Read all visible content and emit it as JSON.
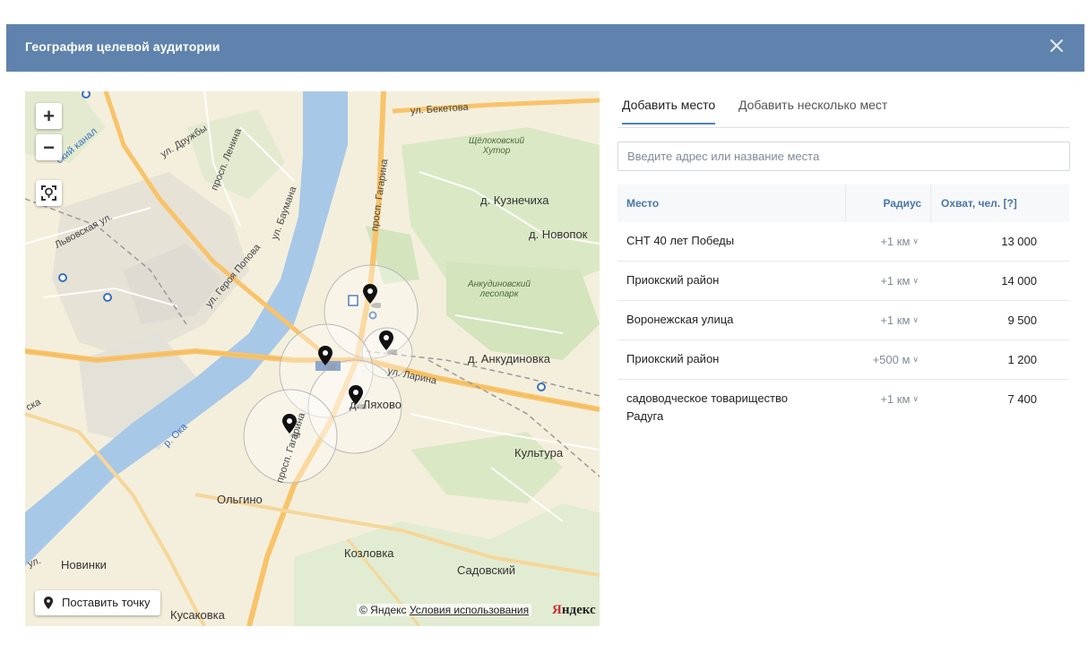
{
  "dialog": {
    "title": "География целевой аудитории",
    "close_icon": "close-icon"
  },
  "map": {
    "zoom_in": "+",
    "zoom_out": "−",
    "place_point_label": "Поставить точку",
    "copyright_text": "© Яндекс",
    "terms_link": "Условия использования",
    "logo_ya": "Я",
    "logo_rest": "ндекс",
    "labels": {
      "beketova": "ул. Бекетова",
      "druzhby": "ул. Дружбы",
      "lenina": "просп. Ленина",
      "gagarina": "просп. Гагарина",
      "baumana": "ул. Баумана",
      "lvovskaya": "Львовская ул.",
      "geroya_popova": "ул. Героя Попова",
      "kanal": "ский канал",
      "shchelokovsky": "Щёлоковский\nХутор",
      "kuznechikha": "д. Кузнечиха",
      "novopok": "д. Новопок",
      "ankudinovsky": "Анкудиновский\nлесопарк",
      "ankudinovka": "д. Анкудиновка",
      "larina": "ул. Ларина",
      "lyakhovo": "д. Ляхово",
      "oka": "р. Ока",
      "gagarina2": "просп. Гагарина",
      "kultura": "Культура",
      "olgino": "Ольгино",
      "kozlovka": "Козловка",
      "sadovsky": "Садовский",
      "novinki": "Новинки",
      "kusakovka": "Кусаковка",
      "ul_left": "ул.",
      "sk": "ска"
    }
  },
  "tabs": [
    {
      "label": "Добавить место",
      "active": true
    },
    {
      "label": "Добавить несколько мест",
      "active": false
    }
  ],
  "search": {
    "placeholder": "Введите адрес или название места",
    "value": ""
  },
  "table": {
    "columns": [
      "Место",
      "Радиус",
      "Охват, чел. [?]"
    ],
    "rows": [
      {
        "place": "СНТ 40 лет Победы",
        "radius": "+1 км",
        "reach": "13 000"
      },
      {
        "place": "Приокский район",
        "radius": "+1 км",
        "reach": "14 000"
      },
      {
        "place": "Воронежская улица",
        "radius": "+1 км",
        "reach": "9 500"
      },
      {
        "place": "Приокский район",
        "radius": "+500 м",
        "reach": "1 200"
      },
      {
        "place": "садоводческое товарищество Радуга",
        "radius": "+1 км",
        "reach": "7 400"
      }
    ]
  },
  "colors": {
    "header": "#5f83ad",
    "accent": "#5181b8",
    "river": "#a8c8e8",
    "road_major": "#f8c36a",
    "park": "#d9e8c4"
  }
}
